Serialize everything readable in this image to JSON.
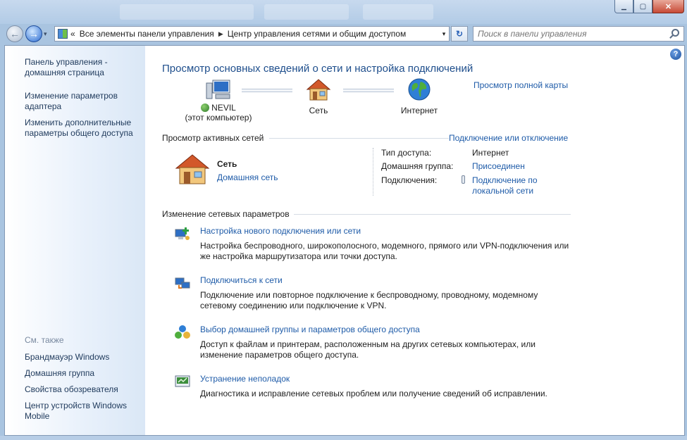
{
  "window": {
    "minimize_symbol": "▁",
    "maximize_symbol": "▢",
    "close_symbol": "✕"
  },
  "nav": {
    "back_symbol": "←",
    "forward_symbol": "→",
    "history_symbol": "▾",
    "breadcrumb_prefix": "«",
    "breadcrumb": [
      "Все элементы панели управления",
      "Центр управления сетями и общим доступом"
    ],
    "breadcrumb_sep": "▶",
    "address_dropdown": "▾",
    "refresh_symbol": "↻",
    "search_placeholder": "Поиск в панели управления"
  },
  "sidebar": {
    "links": [
      "Панель управления - домашняя страница",
      "Изменение параметров адаптера",
      "Изменить дополнительные параметры общего доступа"
    ],
    "see_also_label": "См. также",
    "see_also": [
      "Брандмауэр Windows",
      "Домашняя группа",
      "Свойства обозревателя",
      "Центр устройств Windows Mobile"
    ]
  },
  "help_symbol": "?",
  "main": {
    "title": "Просмотр основных сведений о сети и настройка подключений",
    "full_map_link": "Просмотр полной карты",
    "map": {
      "computer_name": "NEVIL",
      "computer_sub": "(этот компьютер)",
      "network": "Сеть",
      "internet": "Интернет"
    },
    "active_networks": {
      "heading": "Просмотр активных сетей",
      "connect_link": "Подключение или отключение",
      "network_name": "Сеть",
      "network_type": "Домашняя сеть",
      "access_type_label": "Тип доступа:",
      "access_type_value": "Интернет",
      "homegroup_label": "Домашняя группа:",
      "homegroup_value": "Присоединен",
      "connections_label": "Подключения:",
      "connections_value": "Подключение по локальной сети"
    },
    "change_settings": {
      "heading": "Изменение сетевых параметров",
      "tasks": [
        {
          "title": "Настройка нового подключения или сети",
          "desc": "Настройка беспроводного, широкополосного, модемного, прямого или VPN-подключения или же настройка маршрутизатора или точки доступа.",
          "icon": "new-connection-icon"
        },
        {
          "title": "Подключиться к сети",
          "desc": "Подключение или повторное подключение к беспроводному, проводному, модемному сетевому соединению или подключение к VPN.",
          "icon": "connect-network-icon"
        },
        {
          "title": "Выбор домашней группы и параметров общего доступа",
          "desc": "Доступ к файлам и принтерам, расположенным на других сетевых компьютерах, или изменение параметров общего доступа.",
          "icon": "homegroup-icon"
        },
        {
          "title": "Устранение неполадок",
          "desc": "Диагностика и исправление сетевых проблем или получение сведений об исправлении.",
          "icon": "troubleshoot-icon"
        }
      ]
    }
  }
}
